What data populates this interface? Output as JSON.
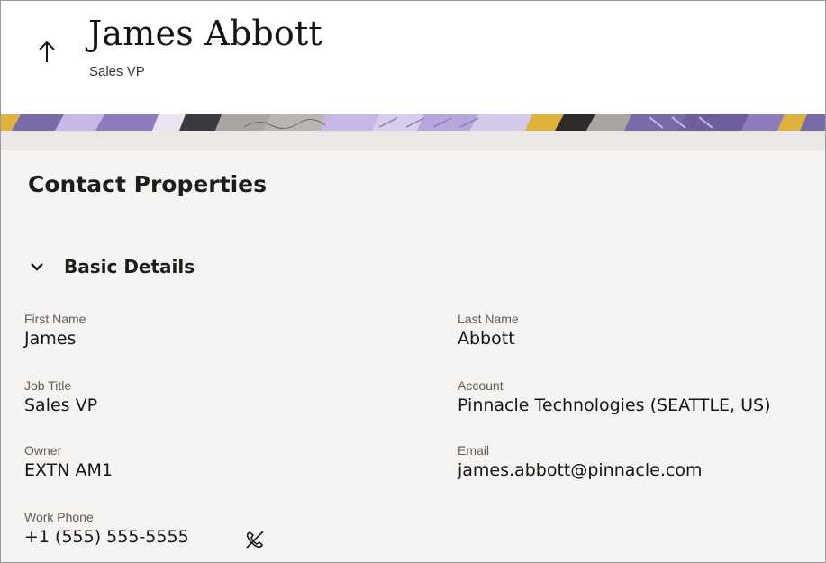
{
  "header": {
    "title": "James Abbott",
    "subtitle": "Sales VP"
  },
  "section": {
    "title": "Contact Properties"
  },
  "group": {
    "label": "Basic Details",
    "expanded": true
  },
  "fields": {
    "first_name": {
      "label": "First Name",
      "value": "James"
    },
    "last_name": {
      "label": "Last Name",
      "value": "Abbott"
    },
    "job_title": {
      "label": "Job Title",
      "value": "Sales VP"
    },
    "account": {
      "label": "Account",
      "value": "Pinnacle Technologies (SEATTLE, US)"
    },
    "owner": {
      "label": "Owner",
      "value": "EXTN AM1"
    },
    "email": {
      "label": "Email",
      "value": "james.abbott@pinnacle.com"
    },
    "work_phone": {
      "label": "Work Phone",
      "value": "+1 (555) 555-5555"
    }
  },
  "icons": {
    "back": "arrow-up-icon",
    "collapse": "chevron-down-icon",
    "call": "phone-off-icon"
  },
  "colors": {
    "banner_purple": "#7b6aa8",
    "banner_lilac": "#c8b6e6",
    "banner_gold": "#e0b23b",
    "banner_gray": "#a9a6a2",
    "banner_dark": "#2e2b2a",
    "page_bg": "#f6f4f2"
  }
}
